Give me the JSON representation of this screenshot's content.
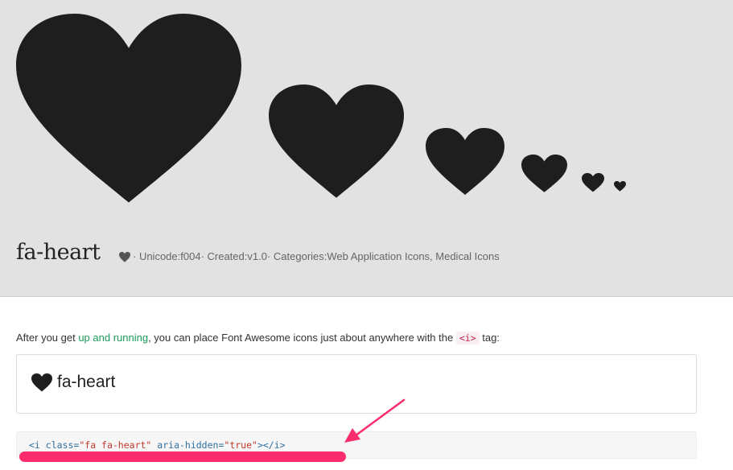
{
  "icon": {
    "name": "fa-heart",
    "meta_prefix": "· Unicode: ",
    "unicode": "f004",
    "created_prefix": " · Created: ",
    "created": "v1.0",
    "categories_prefix": " · Categories: ",
    "categories": "Web Application Icons, Medical Icons"
  },
  "intro": {
    "before": "After you get ",
    "link": "up and running",
    "middle": ", you can place Font Awesome icons just about anywhere with the ",
    "tag": "<i>",
    "after": " tag:"
  },
  "demo": {
    "label": "fa-heart"
  },
  "code": {
    "open": "<i",
    "attr_class": "class=",
    "val_class": "\"fa fa-heart\"",
    "attr_aria": "aria-hidden=",
    "val_aria": "\"true\"",
    "close": "></i>"
  },
  "colors": {
    "hero_bg": "#e2e2e2",
    "heart": "#1e1e1e",
    "link": "#1a9a5a",
    "annotation": "#fb2d6c"
  },
  "icons": [
    "heart-icon",
    "arrow-annotation"
  ]
}
